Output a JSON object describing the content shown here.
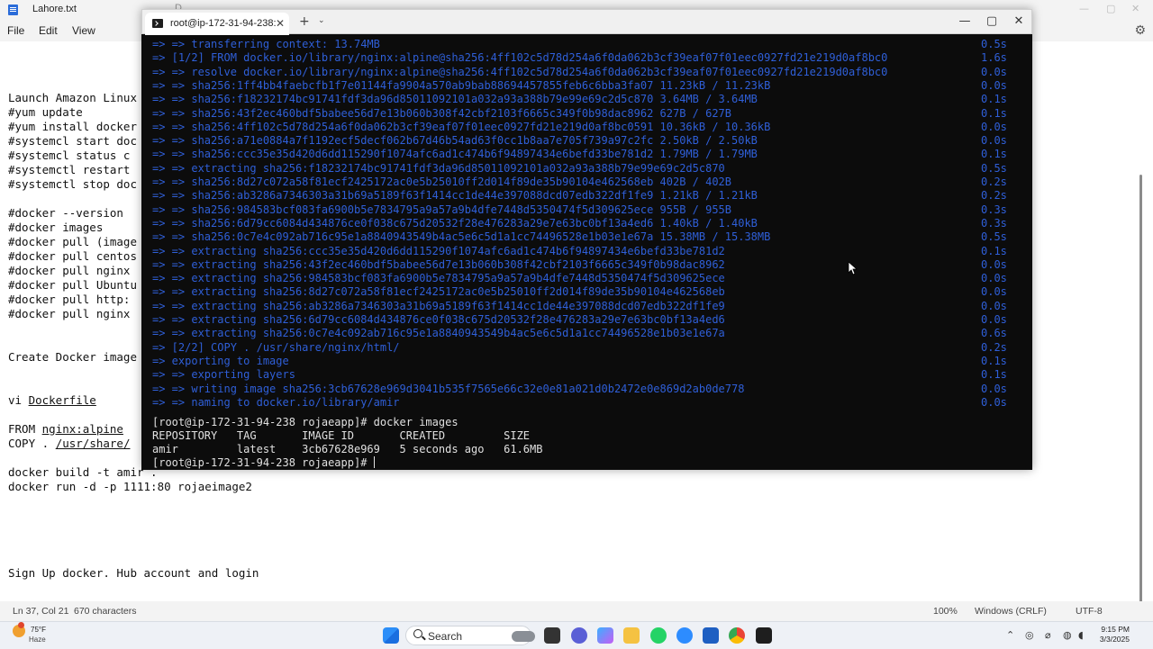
{
  "notepad": {
    "title": "Lahore.txt",
    "background_tab": "D",
    "menu": [
      "File",
      "Edit",
      "View"
    ],
    "lines": [
      "Launch Amazon Linux",
      "#yum update",
      "#yum install docker",
      "#systemcl start doc",
      "#systemcl status c",
      "#systemctl restart",
      "#systemctl stop doc",
      "",
      "#docker --version",
      "#docker images",
      "#docker pull (image",
      "#docker pull centos",
      "#docker pull nginx",
      "#docker pull Ubuntu",
      "#docker pull http:",
      "#docker pull nginx"
    ],
    "create_line": "Create Docker image",
    "vi_prefix": "vi ",
    "vi_file": "Dockerfile",
    "from_prefix": "FROM ",
    "from_image": "nginx:alpine",
    "copy_prefix": "COPY . ",
    "copy_path": "/usr/share/",
    "build_line": "docker build -t amir .",
    "run_line": "docker run -d -p 1111:80 rojaeimage2",
    "signup_line": "Sign Up docker. Hub account and login",
    "status": {
      "position": "Ln 37, Col 21",
      "chars": "670 characters",
      "zoom": "100%",
      "eol": "Windows (CRLF)",
      "encoding": "UTF-8"
    }
  },
  "terminal": {
    "tab_title": "root@ip-172-31-94-238:",
    "build_lines": [
      {
        "text": "=> => transferring context: 13.74MB",
        "time": "0.5s"
      },
      {
        "text": "=> [1/2] FROM docker.io/library/nginx:alpine@sha256:4ff102c5d78d254a6f0da062b3cf39eaf07f01eec0927fd21e219d0af8bc0",
        "time": "1.6s"
      },
      {
        "text": "=> => resolve docker.io/library/nginx:alpine@sha256:4ff102c5d78d254a6f0da062b3cf39eaf07f01eec0927fd21e219d0af8bc0",
        "time": "0.0s"
      },
      {
        "text": "=> => sha256:1ff4bb4faebcfb1f7e01144fa9904a570ab9bab88694457855feb6c6bba3fa07 11.23kB / 11.23kB",
        "time": "0.0s"
      },
      {
        "text": "=> => sha256:f18232174bc91741fdf3da96d85011092101a032a93a388b79e99e69c2d5c870 3.64MB / 3.64MB",
        "time": "0.1s"
      },
      {
        "text": "=> => sha256:43f2ec460bdf5babee56d7e13b060b308f42cbf2103f6665c349f0b98dac8962 627B / 627B",
        "time": "0.1s"
      },
      {
        "text": "=> => sha256:4ff102c5d78d254a6f0da062b3cf39eaf07f01eec0927fd21e219d0af8bc0591 10.36kB / 10.36kB",
        "time": "0.0s"
      },
      {
        "text": "=> => sha256:a71e0884a7f1192ecf5decf062b67d46b54ad63f0cc1b8aa7e705f739a97c2fc 2.50kB / 2.50kB",
        "time": "0.0s"
      },
      {
        "text": "=> => sha256:ccc35e35d420d6dd115290f1074afc6ad1c474b6f94897434e6befd33be781d2 1.79MB / 1.79MB",
        "time": "0.1s"
      },
      {
        "text": "=> => extracting sha256:f18232174bc91741fdf3da96d85011092101a032a93a388b79e99e69c2d5c870",
        "time": "0.5s"
      },
      {
        "text": "=> => sha256:8d27c072a58f81ecf2425172ac0e5b25010ff2d014f89de35b90104e462568eb 402B / 402B",
        "time": "0.2s"
      },
      {
        "text": "=> => sha256:ab3286a7346303a31b69a5189f63f1414cc1de44e397088dcd07edb322df1fe9 1.21kB / 1.21kB",
        "time": "0.2s"
      },
      {
        "text": "=> => sha256:984583bcf083fa6900b5e7834795a9a57a9b4dfe7448d5350474f5d309625ece 955B / 955B",
        "time": "0.3s"
      },
      {
        "text": "=> => sha256:6d79cc6084d434876ce0f038c675d20532f28e476283a29e7e63bc0bf13a4ed6 1.40kB / 1.40kB",
        "time": "0.3s"
      },
      {
        "text": "=> => sha256:0c7e4c092ab716c95e1a8840943549b4ac5e6c5d1a1cc74496528e1b03e1e67a 15.38MB / 15.38MB",
        "time": "0.5s"
      },
      {
        "text": "=> => extracting sha256:ccc35e35d420d6dd115290f1074afc6ad1c474b6f94897434e6befd33be781d2",
        "time": "0.1s"
      },
      {
        "text": "=> => extracting sha256:43f2ec460bdf5babee56d7e13b060b308f42cbf2103f6665c349f0b98dac8962",
        "time": "0.0s"
      },
      {
        "text": "=> => extracting sha256:984583bcf083fa6900b5e7834795a9a57a9b4dfe7448d5350474f5d309625ece",
        "time": "0.0s"
      },
      {
        "text": "=> => extracting sha256:8d27c072a58f81ecf2425172ac0e5b25010ff2d014f89de35b90104e462568eb",
        "time": "0.0s"
      },
      {
        "text": "=> => extracting sha256:ab3286a7346303a31b69a5189f63f1414cc1de44e397088dcd07edb322df1fe9",
        "time": "0.0s"
      },
      {
        "text": "=> => extracting sha256:6d79cc6084d434876ce0f038c675d20532f28e476283a29e7e63bc0bf13a4ed6",
        "time": "0.0s"
      },
      {
        "text": "=> => extracting sha256:0c7e4c092ab716c95e1a8840943549b4ac5e6c5d1a1cc74496528e1b03e1e67a",
        "time": "0.6s"
      },
      {
        "text": "=> [2/2] COPY . /usr/share/nginx/html/",
        "time": "0.2s"
      },
      {
        "text": "=> exporting to image",
        "time": "0.1s"
      },
      {
        "text": "=> => exporting layers",
        "time": "0.1s"
      },
      {
        "text": "=> => writing image sha256:3cb67628e969d3041b535f7565e66c32e0e81a021d0b2472e0e869d2ab0de778",
        "time": "0.0s"
      },
      {
        "text": "=> => naming to docker.io/library/amir",
        "time": "0.0s"
      }
    ],
    "prompt_cmd": "[root@ip-172-31-94-238 rojaeapp]# docker images",
    "table_header": "REPOSITORY   TAG       IMAGE ID       CREATED         SIZE",
    "table_row": "amir         latest    3cb67628e969   5 seconds ago   61.6MB",
    "prompt_end": "[root@ip-172-31-94-238 rojaeapp]# "
  },
  "taskbar": {
    "temp": "75°F",
    "condition": "Haze",
    "search": "Search",
    "time": "9:15 PM",
    "date": "3/3/2025",
    "accent": "#2f5fd8"
  }
}
